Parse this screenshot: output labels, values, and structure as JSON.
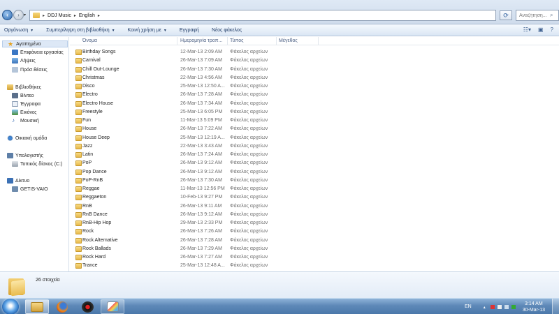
{
  "address": {
    "crumbs": [
      "DDJ Music",
      "English"
    ],
    "search_placeholder": "Αναζήτηση..."
  },
  "toolbar": {
    "organize": "Οργάνωση",
    "include_library": "Συμπερίληψη στη βιβλιοθήκη",
    "share_with": "Κοινή χρήση με",
    "burn": "Εγγραφή",
    "new_folder": "Νέος φάκελος"
  },
  "sidebar": {
    "favorites": "Αγαπημένα",
    "desktop": "Επιφάνεια εργασίας",
    "downloads": "Λήψεις",
    "recent": "Πρόσ.θέσεις",
    "libraries": "Βιβλιοθήκες",
    "videos": "Βίντεο",
    "documents": "Έγγραφα",
    "pictures": "Εικόνες",
    "music": "Μουσική",
    "homegroup": "Οικιακή ομάδα",
    "computer": "Υπολογιστής",
    "local_disk": "Τοπικός δίσκος (C:)",
    "network": "Δίκτυο",
    "network_pc": "GETIS-VAIO"
  },
  "columns": {
    "name": "Όνομα",
    "date": "Ημερομηνία τροπ...",
    "type": "Τύπος",
    "size": "Μέγεθος"
  },
  "files": [
    {
      "name": "Birthday Songs",
      "date": "12-Mar-13 2:09 AM",
      "type": "Φάκελος αρχείων"
    },
    {
      "name": "Carnival",
      "date": "26-Mar-13 7:09 AM",
      "type": "Φάκελος αρχείων"
    },
    {
      "name": "Chill Out-Lounge",
      "date": "26-Mar-13 7:30 AM",
      "type": "Φάκελος αρχείων"
    },
    {
      "name": "Christmas",
      "date": "22-Mar-13 4:56 AM",
      "type": "Φάκελος αρχείων"
    },
    {
      "name": "Disco",
      "date": "25-Mar-13 12:50 A...",
      "type": "Φάκελος αρχείων"
    },
    {
      "name": "Electro",
      "date": "26-Mar-13 7:28 AM",
      "type": "Φάκελος αρχείων"
    },
    {
      "name": "Electro House",
      "date": "26-Mar-13 7:34 AM",
      "type": "Φάκελος αρχείων"
    },
    {
      "name": "Freestyle",
      "date": "25-Mar-13 6:05 PM",
      "type": "Φάκελος αρχείων"
    },
    {
      "name": "Fun",
      "date": "11-Mar-13 5:09 PM",
      "type": "Φάκελος αρχείων"
    },
    {
      "name": "House",
      "date": "26-Mar-13 7:22 AM",
      "type": "Φάκελος αρχείων"
    },
    {
      "name": "House Deep",
      "date": "25-Mar-13 12:19 A...",
      "type": "Φάκελος αρχείων"
    },
    {
      "name": "Jazz",
      "date": "22-Mar-13 3:43 AM",
      "type": "Φάκελος αρχείων"
    },
    {
      "name": "Latin",
      "date": "26-Mar-13 7:24 AM",
      "type": "Φάκελος αρχείων"
    },
    {
      "name": "PoP",
      "date": "26-Mar-13 9:12 AM",
      "type": "Φάκελος αρχείων"
    },
    {
      "name": "Pop Dance",
      "date": "26-Mar-13 9:12 AM",
      "type": "Φάκελος αρχείων"
    },
    {
      "name": "PoP-RnB",
      "date": "26-Mar-13 7:30 AM",
      "type": "Φάκελος αρχείων"
    },
    {
      "name": "Reggae",
      "date": "11-Mar-13 12:56 PM",
      "type": "Φάκελος αρχείων"
    },
    {
      "name": "Reggaeton",
      "date": "10-Feb-13 9:27 PM",
      "type": "Φάκελος αρχείων"
    },
    {
      "name": "RnB",
      "date": "26-Mar-13 9:11 AM",
      "type": "Φάκελος αρχείων"
    },
    {
      "name": "RnB Dance",
      "date": "26-Mar-13 9:12 AM",
      "type": "Φάκελος αρχείων"
    },
    {
      "name": "RnB-Hip Hop",
      "date": "29-Mar-13 2:33 PM",
      "type": "Φάκελος αρχείων"
    },
    {
      "name": "Rock",
      "date": "26-Mar-13 7:26 AM",
      "type": "Φάκελος αρχείων"
    },
    {
      "name": "Rock Alternative",
      "date": "26-Mar-13 7:28 AM",
      "type": "Φάκελος αρχείων"
    },
    {
      "name": "Rock Ballads",
      "date": "26-Mar-13 7:29 AM",
      "type": "Φάκελος αρχείων"
    },
    {
      "name": "Rock Hard",
      "date": "26-Mar-13 7:27 AM",
      "type": "Φάκελος αρχείων"
    },
    {
      "name": "Trance",
      "date": "25-Mar-13 12:48 A...",
      "type": "Φάκελος αρχείων"
    }
  ],
  "details": {
    "count": "26 στοιχεία"
  },
  "taskbar": {
    "lang": "EN",
    "time": "3:14 AM",
    "date": "30-Mar-13"
  }
}
